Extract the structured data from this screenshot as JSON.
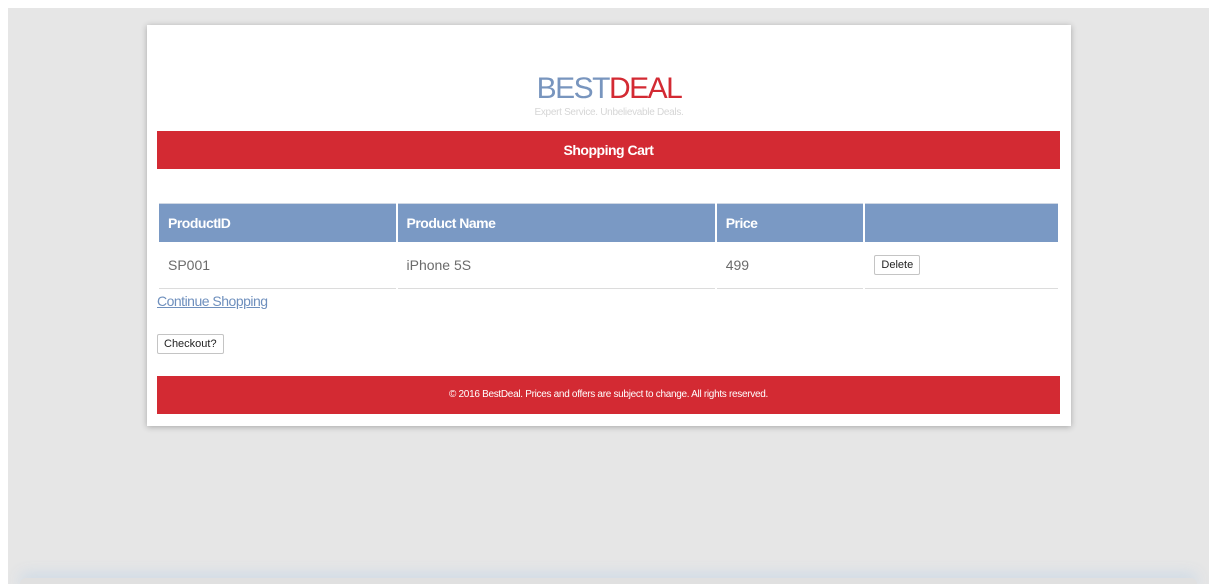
{
  "logo": {
    "part1": "BEST",
    "part2": "DEAL",
    "tagline": "Expert Service. Unbelievable Deals.",
    "colors": {
      "part1": "#7895be",
      "part2": "#d32a33"
    }
  },
  "header": {
    "title": "Shopping Cart"
  },
  "cart_table": {
    "columns": [
      "ProductID",
      "Product Name",
      "Price",
      ""
    ],
    "rows": [
      {
        "product_id": "SP001",
        "product_name": "iPhone 5S",
        "price": "499",
        "action_label": "Delete"
      }
    ]
  },
  "actions": {
    "continue_shopping": "Continue Shopping",
    "checkout": "Checkout?"
  },
  "footer": {
    "text": "© 2016 BestDeal. Prices and offers are subject to change. All rights reserved."
  },
  "theme": {
    "accent_red": "#d32a33",
    "table_header_blue": "#7a99c4",
    "page_background": "#e6e6e6"
  }
}
